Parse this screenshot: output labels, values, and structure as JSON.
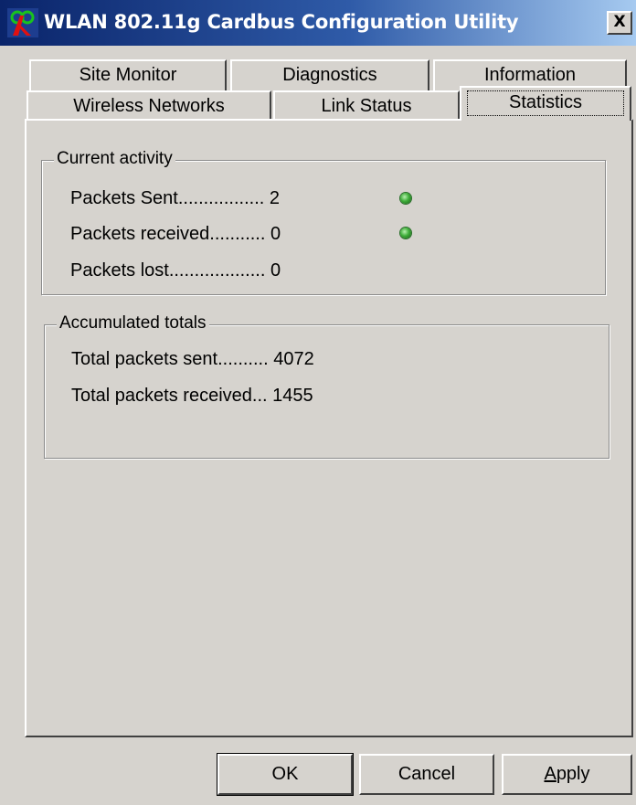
{
  "window": {
    "title": "WLAN 802.11g Cardbus Configuration Utility",
    "close_label": "X"
  },
  "tabs": {
    "back_row": [
      "Site Monitor",
      "Diagnostics",
      "Information"
    ],
    "front_row": [
      "Wireless Networks",
      "Link Status",
      "Statistics"
    ],
    "active": "Statistics"
  },
  "current_activity": {
    "legend": "Current activity",
    "rows": [
      {
        "label": "Packets Sent.................",
        "value": "2",
        "indicator": "green-led"
      },
      {
        "label": "Packets received...........",
        "value": "0",
        "indicator": "green-led"
      },
      {
        "label": "Packets lost...................",
        "value": "0"
      }
    ]
  },
  "accumulated_totals": {
    "legend": "Accumulated totals",
    "rows": [
      {
        "label": "Total packets sent..........",
        "value": "4072"
      },
      {
        "label": "Total packets received...",
        "value": "1455"
      }
    ]
  },
  "buttons": {
    "ok": "OK",
    "cancel": "Cancel",
    "apply_underline": "A",
    "apply_rest": "pply"
  },
  "colors": {
    "face": "#d6d3ce",
    "title_gradient_start": "#0a246a",
    "title_gradient_end": "#a6caf0",
    "led": "#3fae3a"
  }
}
